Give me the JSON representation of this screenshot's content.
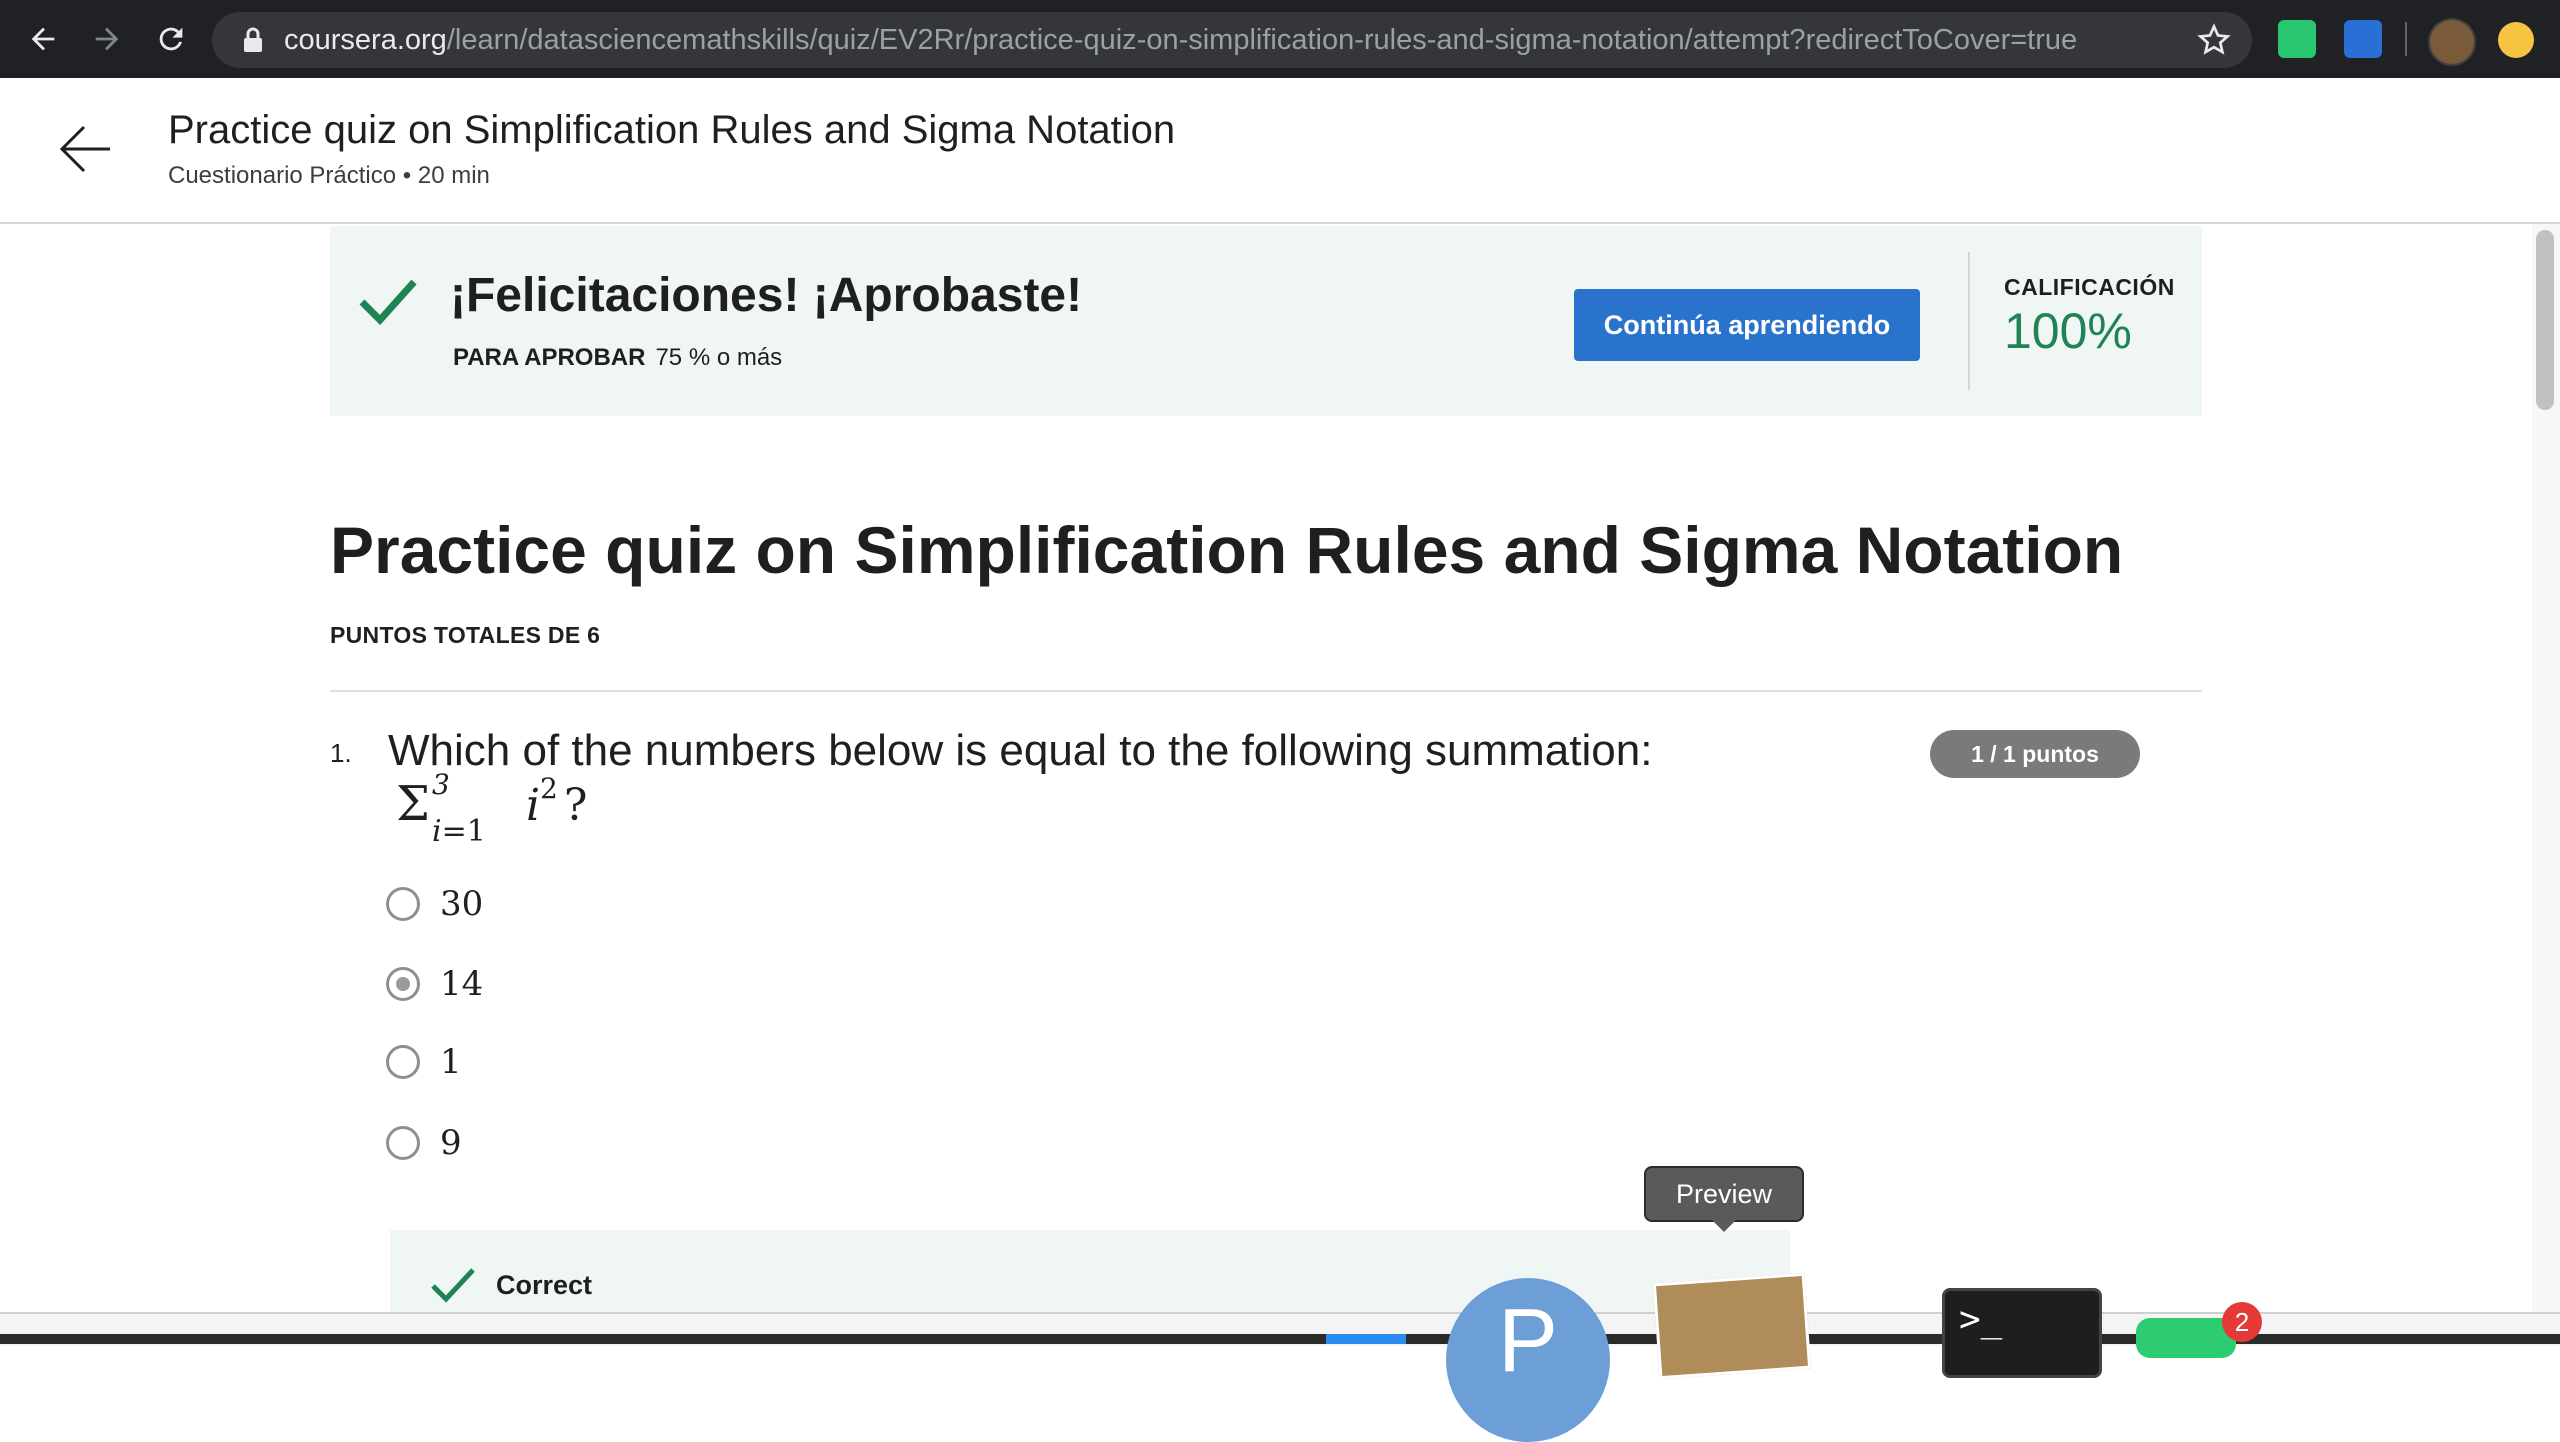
{
  "browser": {
    "url_host": "coursera.org",
    "url_path": "/learn/datasciencemathskills/quiz/EV2Rr/practice-quiz-on-simplification-rules-and-sigma-notation/attempt?redirectToCover=true"
  },
  "header": {
    "title": "Practice quiz on Simplification Rules and Sigma Notation",
    "subtitle": "Cuestionario Práctico • 20 min"
  },
  "result": {
    "message": "¡Felicitaciones! ¡Aprobaste!",
    "pass_label": "PARA APROBAR",
    "pass_value": "75 % o más",
    "continue_label": "Continúa aprendiendo",
    "grade_label": "CALIFICACIÓN",
    "grade_value": "100%",
    "accent_color": "#1f8354",
    "button_color": "#2a73cc"
  },
  "quiz": {
    "title": "Practice quiz on Simplification Rules and Sigma Notation",
    "total_points": "PUNTOS TOTALES DE 6"
  },
  "question": {
    "number": "1.",
    "text": "Which of the numbers below is equal to the following summation:",
    "formula": {
      "sigma": "Σ",
      "upper": "3",
      "lower_var": "i",
      "lower_rest": "=1",
      "body": "i",
      "exponent": "2",
      "suffix": "?"
    },
    "points": "1 / 1 puntos",
    "options": [
      {
        "label": "30",
        "selected": false
      },
      {
        "label": "14",
        "selected": true
      },
      {
        "label": "1",
        "selected": false
      },
      {
        "label": "9",
        "selected": false
      }
    ],
    "feedback": "Correct"
  },
  "dock": {
    "tooltip": "Preview",
    "circle_letter": "P",
    "terminal_prompt": ">_",
    "badge_count": "2"
  }
}
